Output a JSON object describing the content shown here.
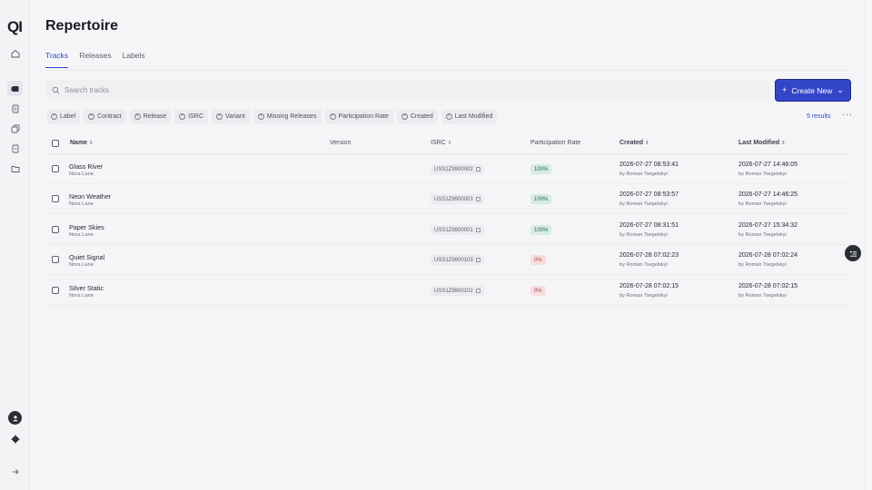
{
  "app": {
    "logo": "QI"
  },
  "sidebar": {
    "icons": [
      {
        "name": "home-icon"
      },
      {
        "name": "repertoire-icon",
        "active": true
      },
      {
        "name": "document-icon"
      },
      {
        "name": "stack-icon"
      },
      {
        "name": "file-icon"
      },
      {
        "name": "folder-icon"
      }
    ],
    "bottom": [
      "user-icon",
      "gear-icon",
      "arrow-right-icon"
    ]
  },
  "page": {
    "title": "Repertoire"
  },
  "tabs": [
    {
      "label": "Tracks",
      "active": true
    },
    {
      "label": "Releases"
    },
    {
      "label": "Labels"
    }
  ],
  "search": {
    "placeholder": "Search tracks"
  },
  "create_button": {
    "label": "Create New"
  },
  "filters": [
    "Label",
    "Contract",
    "Release",
    "ISRC",
    "Variant",
    "Missing Releases",
    "Participation Rate",
    "Created",
    "Last Modified"
  ],
  "results": "5 results",
  "table": {
    "headers": {
      "name": "Name",
      "version": "Version",
      "isrc": "ISRC",
      "rate": "Participation Rate",
      "created": "Created",
      "modified": "Last Modified"
    },
    "rows": [
      {
        "title": "Glass River",
        "artist": "Nora Lane",
        "isrc": "USS1Z9900002",
        "rate": "100%",
        "created": "2026-07-27 08:53:41",
        "created_by": "by Roman Tsegelskyi",
        "modified": "2026-07-27 14:46:05",
        "modified_by": "by Roman Tsegelskyi"
      },
      {
        "title": "Neon Weather",
        "artist": "Nora Lane",
        "isrc": "USS1Z9900003",
        "rate": "100%",
        "created": "2026-07-27 08:53:57",
        "created_by": "by Roman Tsegelskyi",
        "modified": "2026-07-27 14:46:25",
        "modified_by": "by Roman Tsegelskyi"
      },
      {
        "title": "Paper Skies",
        "artist": "Nora Lane",
        "isrc": "USS1Z9900001",
        "rate": "100%",
        "created": "2026-07-27 08:31:51",
        "created_by": "by Roman Tsegelskyi",
        "modified": "2026-07-27 15:34:32",
        "modified_by": "by Roman Tsegelskyi"
      },
      {
        "title": "Quiet Signal",
        "artist": "Nora Lane",
        "isrc": "USS1Z9900103",
        "rate": "0%",
        "created": "2026-07-28 07:02:23",
        "created_by": "by Roman Tsegelskyi",
        "modified": "2026-07-28 07:02:24",
        "modified_by": "by Roman Tsegelskyi"
      },
      {
        "title": "Silver Static",
        "artist": "Nora Lane",
        "isrc": "USS1Z9900102",
        "rate": "0%",
        "created": "2026-07-28 07:02:15",
        "created_by": "by Roman Tsegelskyi",
        "modified": "2026-07-28 07:02:15",
        "modified_by": "by Roman Tsegelskyi"
      }
    ]
  },
  "colors": {
    "accent": "#3446c8",
    "full_rate_bg": "#d7ece2",
    "zero_rate_bg": "#f6dede"
  }
}
